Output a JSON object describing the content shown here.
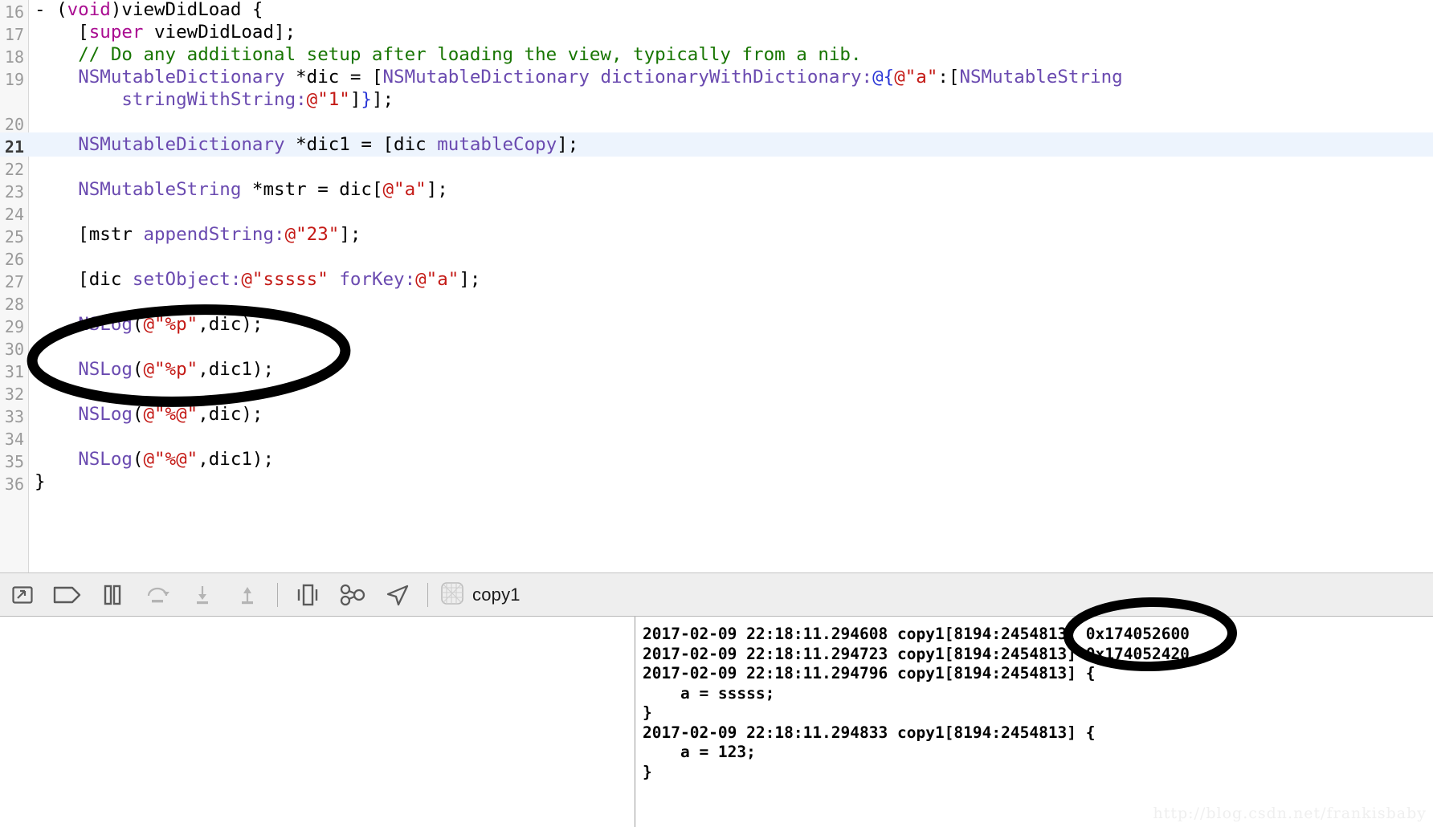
{
  "editor": {
    "first_visible_partial_line": "15",
    "current_line": "21",
    "lines": [
      {
        "num": "16",
        "tokens": [
          {
            "t": "- (",
            "c": "pln"
          },
          {
            "t": "void",
            "c": "kw"
          },
          {
            "t": ")viewDidLoad {",
            "c": "pln"
          }
        ]
      },
      {
        "num": "17",
        "tokens": [
          {
            "t": "    [",
            "c": "pln"
          },
          {
            "t": "super",
            "c": "kw"
          },
          {
            "t": " viewDidLoad];",
            "c": "pln"
          }
        ]
      },
      {
        "num": "18",
        "tokens": [
          {
            "t": "    ",
            "c": "pln"
          },
          {
            "t": "// Do any additional setup after loading the view, typically from a nib.",
            "c": "com"
          }
        ]
      },
      {
        "num": "19",
        "tokens": [
          {
            "t": "    ",
            "c": "pln"
          },
          {
            "t": "NSMutableDictionary",
            "c": "cls"
          },
          {
            "t": " *dic = [",
            "c": "pln"
          },
          {
            "t": "NSMutableDictionary",
            "c": "cls"
          },
          {
            "t": " ",
            "c": "pln"
          },
          {
            "t": "dictionaryWithDictionary:",
            "c": "cls"
          },
          {
            "t": "@{",
            "c": "blu"
          },
          {
            "t": "@\"a\"",
            "c": "str"
          },
          {
            "t": ":[",
            "c": "pln"
          },
          {
            "t": "NSMutableString",
            "c": "cls"
          }
        ]
      },
      {
        "num": "",
        "tokens": [
          {
            "t": "        ",
            "c": "pln"
          },
          {
            "t": "stringWithString:",
            "c": "cls"
          },
          {
            "t": "@\"1\"",
            "c": "str"
          },
          {
            "t": "]",
            "c": "pln"
          },
          {
            "t": "}",
            "c": "blu"
          },
          {
            "t": "];",
            "c": "pln"
          }
        ]
      },
      {
        "num": "20",
        "tokens": []
      },
      {
        "num": "21",
        "tokens": [
          {
            "t": "    ",
            "c": "pln"
          },
          {
            "t": "NSMutableDictionary",
            "c": "cls"
          },
          {
            "t": " *dic1 = [dic ",
            "c": "pln"
          },
          {
            "t": "mutableCopy",
            "c": "cls"
          },
          {
            "t": "];",
            "c": "pln"
          }
        ]
      },
      {
        "num": "22",
        "tokens": []
      },
      {
        "num": "23",
        "tokens": [
          {
            "t": "    ",
            "c": "pln"
          },
          {
            "t": "NSMutableString",
            "c": "cls"
          },
          {
            "t": " *mstr = dic[",
            "c": "pln"
          },
          {
            "t": "@\"a\"",
            "c": "str"
          },
          {
            "t": "];",
            "c": "pln"
          }
        ]
      },
      {
        "num": "24",
        "tokens": []
      },
      {
        "num": "25",
        "tokens": [
          {
            "t": "    [mstr ",
            "c": "pln"
          },
          {
            "t": "appendString:",
            "c": "cls"
          },
          {
            "t": "@\"23\"",
            "c": "str"
          },
          {
            "t": "];",
            "c": "pln"
          }
        ]
      },
      {
        "num": "26",
        "tokens": []
      },
      {
        "num": "27",
        "tokens": [
          {
            "t": "    [dic ",
            "c": "pln"
          },
          {
            "t": "setObject:",
            "c": "cls"
          },
          {
            "t": "@\"sssss\"",
            "c": "str"
          },
          {
            "t": " ",
            "c": "pln"
          },
          {
            "t": "forKey:",
            "c": "cls"
          },
          {
            "t": "@\"a\"",
            "c": "str"
          },
          {
            "t": "];",
            "c": "pln"
          }
        ]
      },
      {
        "num": "28",
        "tokens": []
      },
      {
        "num": "29",
        "tokens": [
          {
            "t": "    ",
            "c": "pln"
          },
          {
            "t": "NSLog",
            "c": "cls"
          },
          {
            "t": "(",
            "c": "pln"
          },
          {
            "t": "@\"%p\"",
            "c": "str"
          },
          {
            "t": ",dic);",
            "c": "pln"
          }
        ]
      },
      {
        "num": "30",
        "tokens": []
      },
      {
        "num": "31",
        "tokens": [
          {
            "t": "    ",
            "c": "pln"
          },
          {
            "t": "NSLog",
            "c": "cls"
          },
          {
            "t": "(",
            "c": "pln"
          },
          {
            "t": "@\"%p\"",
            "c": "str"
          },
          {
            "t": ",dic1);",
            "c": "pln"
          }
        ]
      },
      {
        "num": "32",
        "tokens": []
      },
      {
        "num": "33",
        "tokens": [
          {
            "t": "    ",
            "c": "pln"
          },
          {
            "t": "NSLog",
            "c": "cls"
          },
          {
            "t": "(",
            "c": "pln"
          },
          {
            "t": "@\"%@\"",
            "c": "str"
          },
          {
            "t": ",dic);",
            "c": "pln"
          }
        ]
      },
      {
        "num": "34",
        "tokens": []
      },
      {
        "num": "35",
        "tokens": [
          {
            "t": "    ",
            "c": "pln"
          },
          {
            "t": "NSLog",
            "c": "cls"
          },
          {
            "t": "(",
            "c": "pln"
          },
          {
            "t": "@\"%@\"",
            "c": "str"
          },
          {
            "t": ",dic1);",
            "c": "pln"
          }
        ]
      },
      {
        "num": "36",
        "tokens": [
          {
            "t": "}",
            "c": "pln"
          }
        ]
      }
    ]
  },
  "debug_toolbar": {
    "buttons": [
      {
        "name": "hide-debug-area-icon",
        "label": "Hide Debug Area"
      },
      {
        "name": "breakpoints-toggle-icon",
        "label": "Deactivate Breakpoints"
      },
      {
        "name": "pause-icon",
        "label": "Pause"
      },
      {
        "name": "step-over-icon",
        "label": "Step Over"
      },
      {
        "name": "step-into-icon",
        "label": "Step Into"
      },
      {
        "name": "step-out-icon",
        "label": "Step Out"
      },
      {
        "name": "debug-view-hierarchy-icon",
        "label": "Debug View Hierarchy"
      },
      {
        "name": "debug-memory-graph-icon",
        "label": "Debug Memory Graph"
      },
      {
        "name": "simulate-location-icon",
        "label": "Simulate Location"
      }
    ],
    "process_icon": "process-grid-icon",
    "process_name": "copy1"
  },
  "console": {
    "lines": [
      "2017-02-09 22:18:11.294608 copy1[8194:2454813] 0x174052600",
      "2017-02-09 22:18:11.294723 copy1[8194:2454813] 0x174052420",
      "2017-02-09 22:18:11.294796 copy1[8194:2454813] {",
      "    a = sssss;",
      "}",
      "2017-02-09 22:18:11.294833 copy1[8194:2454813] {",
      "    a = 123;",
      "}"
    ],
    "watermark": "http://blog.csdn.net/frankisbaby"
  },
  "annotations": {
    "code_ellipse_label": "handwritten-ellipse-around-nslog-pointer-lines",
    "console_ellipse_label": "handwritten-ellipse-around-pointer-addresses",
    "stroke_color": "#000000"
  }
}
